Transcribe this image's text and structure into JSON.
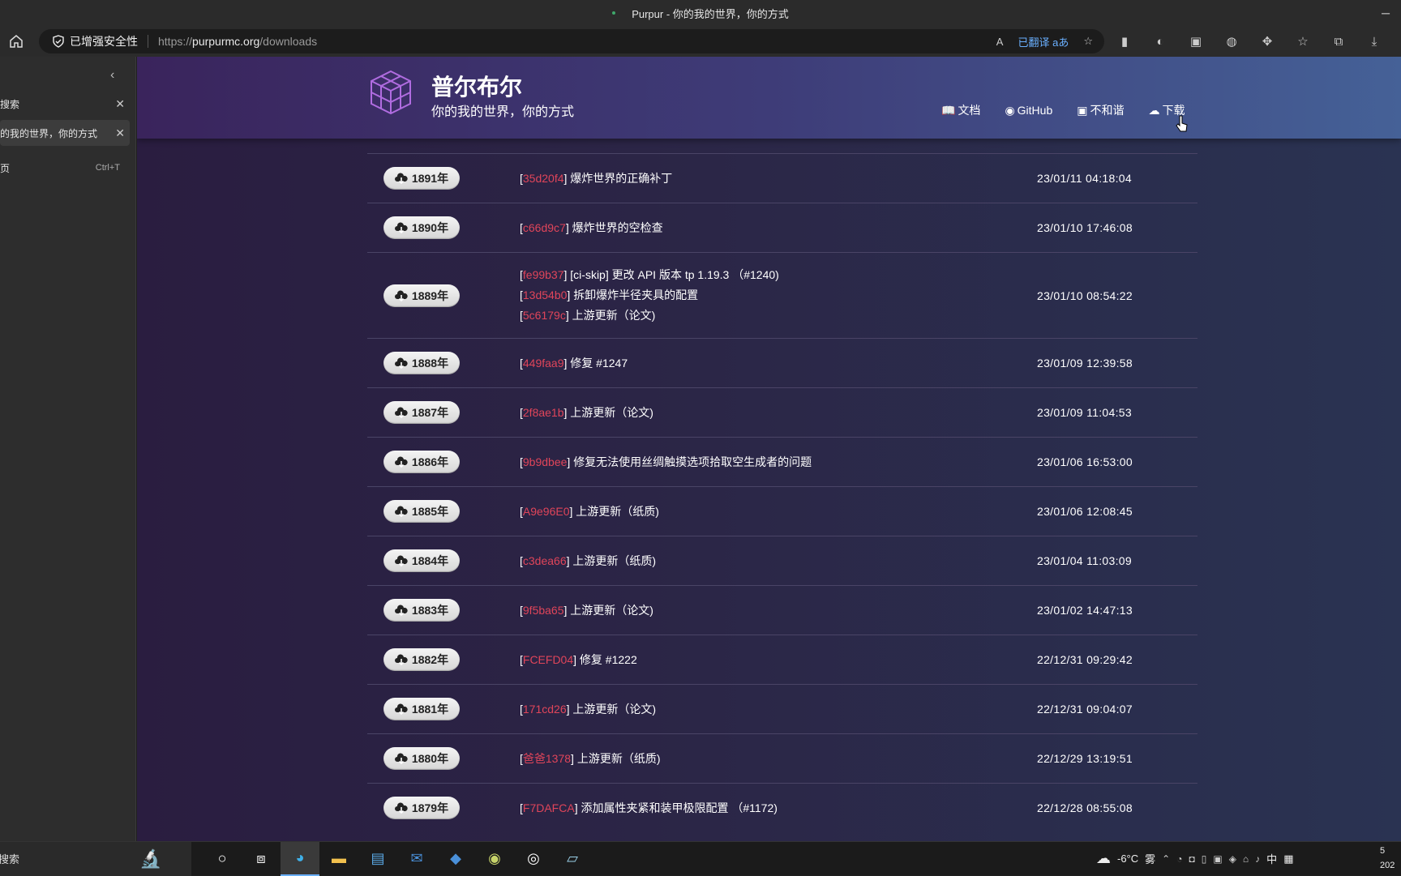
{
  "window": {
    "title": "Purpur - 你的我的世界，你的方式"
  },
  "addressbar": {
    "security_label": "已增强安全性",
    "url_proto": "https://",
    "url_host": "purpurmc.org",
    "url_path": "/downloads",
    "read_aloud": "A",
    "translated_label": "已翻译",
    "translate_icon": "aあ"
  },
  "sidebar": {
    "items": [
      {
        "label": "搜索"
      },
      {
        "label": "的我的世界，你的方式"
      },
      {
        "label": "页",
        "shortcut": "Ctrl+T"
      }
    ]
  },
  "site": {
    "title": "普尔布尔",
    "subtitle": "你的我的世界，你的方式",
    "nav": [
      {
        "icon": "book-icon",
        "label": "文档"
      },
      {
        "icon": "github-icon",
        "label": "GitHub"
      },
      {
        "icon": "chat-icon",
        "label": "不和谐"
      },
      {
        "icon": "cloud-download-icon",
        "label": "下载"
      }
    ]
  },
  "builds": [
    {
      "badge": "1891年",
      "date": "23/01/11 04:18:04",
      "commits": [
        {
          "hash": "35d20f4",
          "msg": "爆炸世界的正确补丁"
        }
      ]
    },
    {
      "badge": "1890年",
      "date": "23/01/10 17:46:08",
      "commits": [
        {
          "hash": "c66d9c7",
          "msg": "爆炸世界的空检查"
        }
      ]
    },
    {
      "badge": "1889年",
      "date": "23/01/10 08:54:22",
      "commits": [
        {
          "hash": "fe99b37",
          "msg": "[ci-skip] 更改 API 版本 tp 1.19.3 （#1240)"
        },
        {
          "hash": "13d54b0",
          "msg": "拆卸爆炸半径夹具的配置"
        },
        {
          "hash": "5c6179c",
          "msg": "上游更新（论文)"
        }
      ]
    },
    {
      "badge": "1888年",
      "date": "23/01/09 12:39:58",
      "commits": [
        {
          "hash": "449faa9",
          "msg": "修复 #1247"
        }
      ]
    },
    {
      "badge": "1887年",
      "date": "23/01/09 11:04:53",
      "commits": [
        {
          "hash": "2f8ae1b",
          "msg": "上游更新（论文)"
        }
      ]
    },
    {
      "badge": "1886年",
      "date": "23/01/06 16:53:00",
      "commits": [
        {
          "hash": "9b9dbee",
          "msg": "修复无法使用丝绸触摸选项拾取空生成者的问题"
        }
      ]
    },
    {
      "badge": "1885年",
      "date": "23/01/06 12:08:45",
      "commits": [
        {
          "hash": "A9e96E0",
          "msg": "上游更新（纸质)"
        }
      ]
    },
    {
      "badge": "1884年",
      "date": "23/01/04 11:03:09",
      "commits": [
        {
          "hash": "c3dea66",
          "msg": "上游更新（纸质)"
        }
      ]
    },
    {
      "badge": "1883年",
      "date": "23/01/02 14:47:13",
      "commits": [
        {
          "hash": "9f5ba65",
          "msg": "上游更新（论文)"
        }
      ]
    },
    {
      "badge": "1882年",
      "date": "22/12/31 09:29:42",
      "commits": [
        {
          "hash": "FCEFD04",
          "msg": "修复 #1222"
        }
      ]
    },
    {
      "badge": "1881年",
      "date": "22/12/31 09:04:07",
      "commits": [
        {
          "hash": "171cd26",
          "msg": "上游更新（论文)"
        }
      ]
    },
    {
      "badge": "1880年",
      "date": "22/12/29 13:19:51",
      "commits": [
        {
          "hash": "爸爸1378",
          "msg": "上游更新（纸质)"
        }
      ]
    },
    {
      "badge": "1879年",
      "date": "22/12/28 08:55:08",
      "commits": [
        {
          "hash": "F7DAFCA",
          "msg": "添加属性夹紧和装甲极限配置 （#1172)"
        }
      ]
    }
  ],
  "taskbar": {
    "search_label": "搜索",
    "weather": "-6°C",
    "weather_desc": "雾",
    "ime": "中",
    "clock_time": "5",
    "clock_date": "202"
  }
}
